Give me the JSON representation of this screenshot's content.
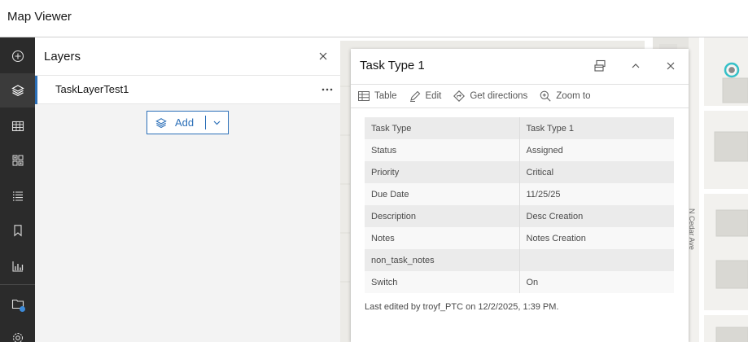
{
  "app": {
    "title": "Map Viewer"
  },
  "rail": {
    "items": [
      {
        "icon": "plus-circle-icon",
        "label": "Add"
      },
      {
        "icon": "layers-icon",
        "label": "Layers",
        "active": true
      },
      {
        "icon": "table-icon",
        "label": "Tables"
      },
      {
        "icon": "basemap-icon",
        "label": "Basemap"
      },
      {
        "icon": "legend-icon",
        "label": "Legend"
      },
      {
        "icon": "bookmark-icon",
        "label": "Bookmarks"
      },
      {
        "icon": "charts-icon",
        "label": "Charts"
      },
      {
        "icon": "tasks-icon",
        "label": "Tasks"
      },
      {
        "icon": "settings-icon",
        "label": "Settings"
      }
    ]
  },
  "layers_panel": {
    "title": "Layers",
    "layers": [
      {
        "name": "TaskLayerTest1"
      }
    ],
    "add_label": "Add"
  },
  "map": {
    "street_label": "N Cedar Ave"
  },
  "popup": {
    "title": "Task Type 1",
    "actions": [
      {
        "icon": "table-icon",
        "label": "Table"
      },
      {
        "icon": "edit-icon",
        "label": "Edit"
      },
      {
        "icon": "directions-icon",
        "label": "Get directions"
      },
      {
        "icon": "zoom-to-icon",
        "label": "Zoom to"
      }
    ],
    "attributes": [
      {
        "key": "Task Type",
        "value": "Task Type 1"
      },
      {
        "key": "Status",
        "value": "Assigned"
      },
      {
        "key": "Priority",
        "value": "Critical"
      },
      {
        "key": "Due Date",
        "value": "11/25/25"
      },
      {
        "key": "Description",
        "value": "Desc Creation"
      },
      {
        "key": "Notes",
        "value": "Notes Creation"
      },
      {
        "key": "non_task_notes",
        "value": ""
      },
      {
        "key": "Switch",
        "value": "On"
      }
    ],
    "last_edited": "Last edited by troyf_PTC on 12/2/2025, 1:39 PM."
  },
  "colors": {
    "accent": "#2b6fb8",
    "rail_bg": "#2b2b2b",
    "selection": "#34c0c8"
  }
}
